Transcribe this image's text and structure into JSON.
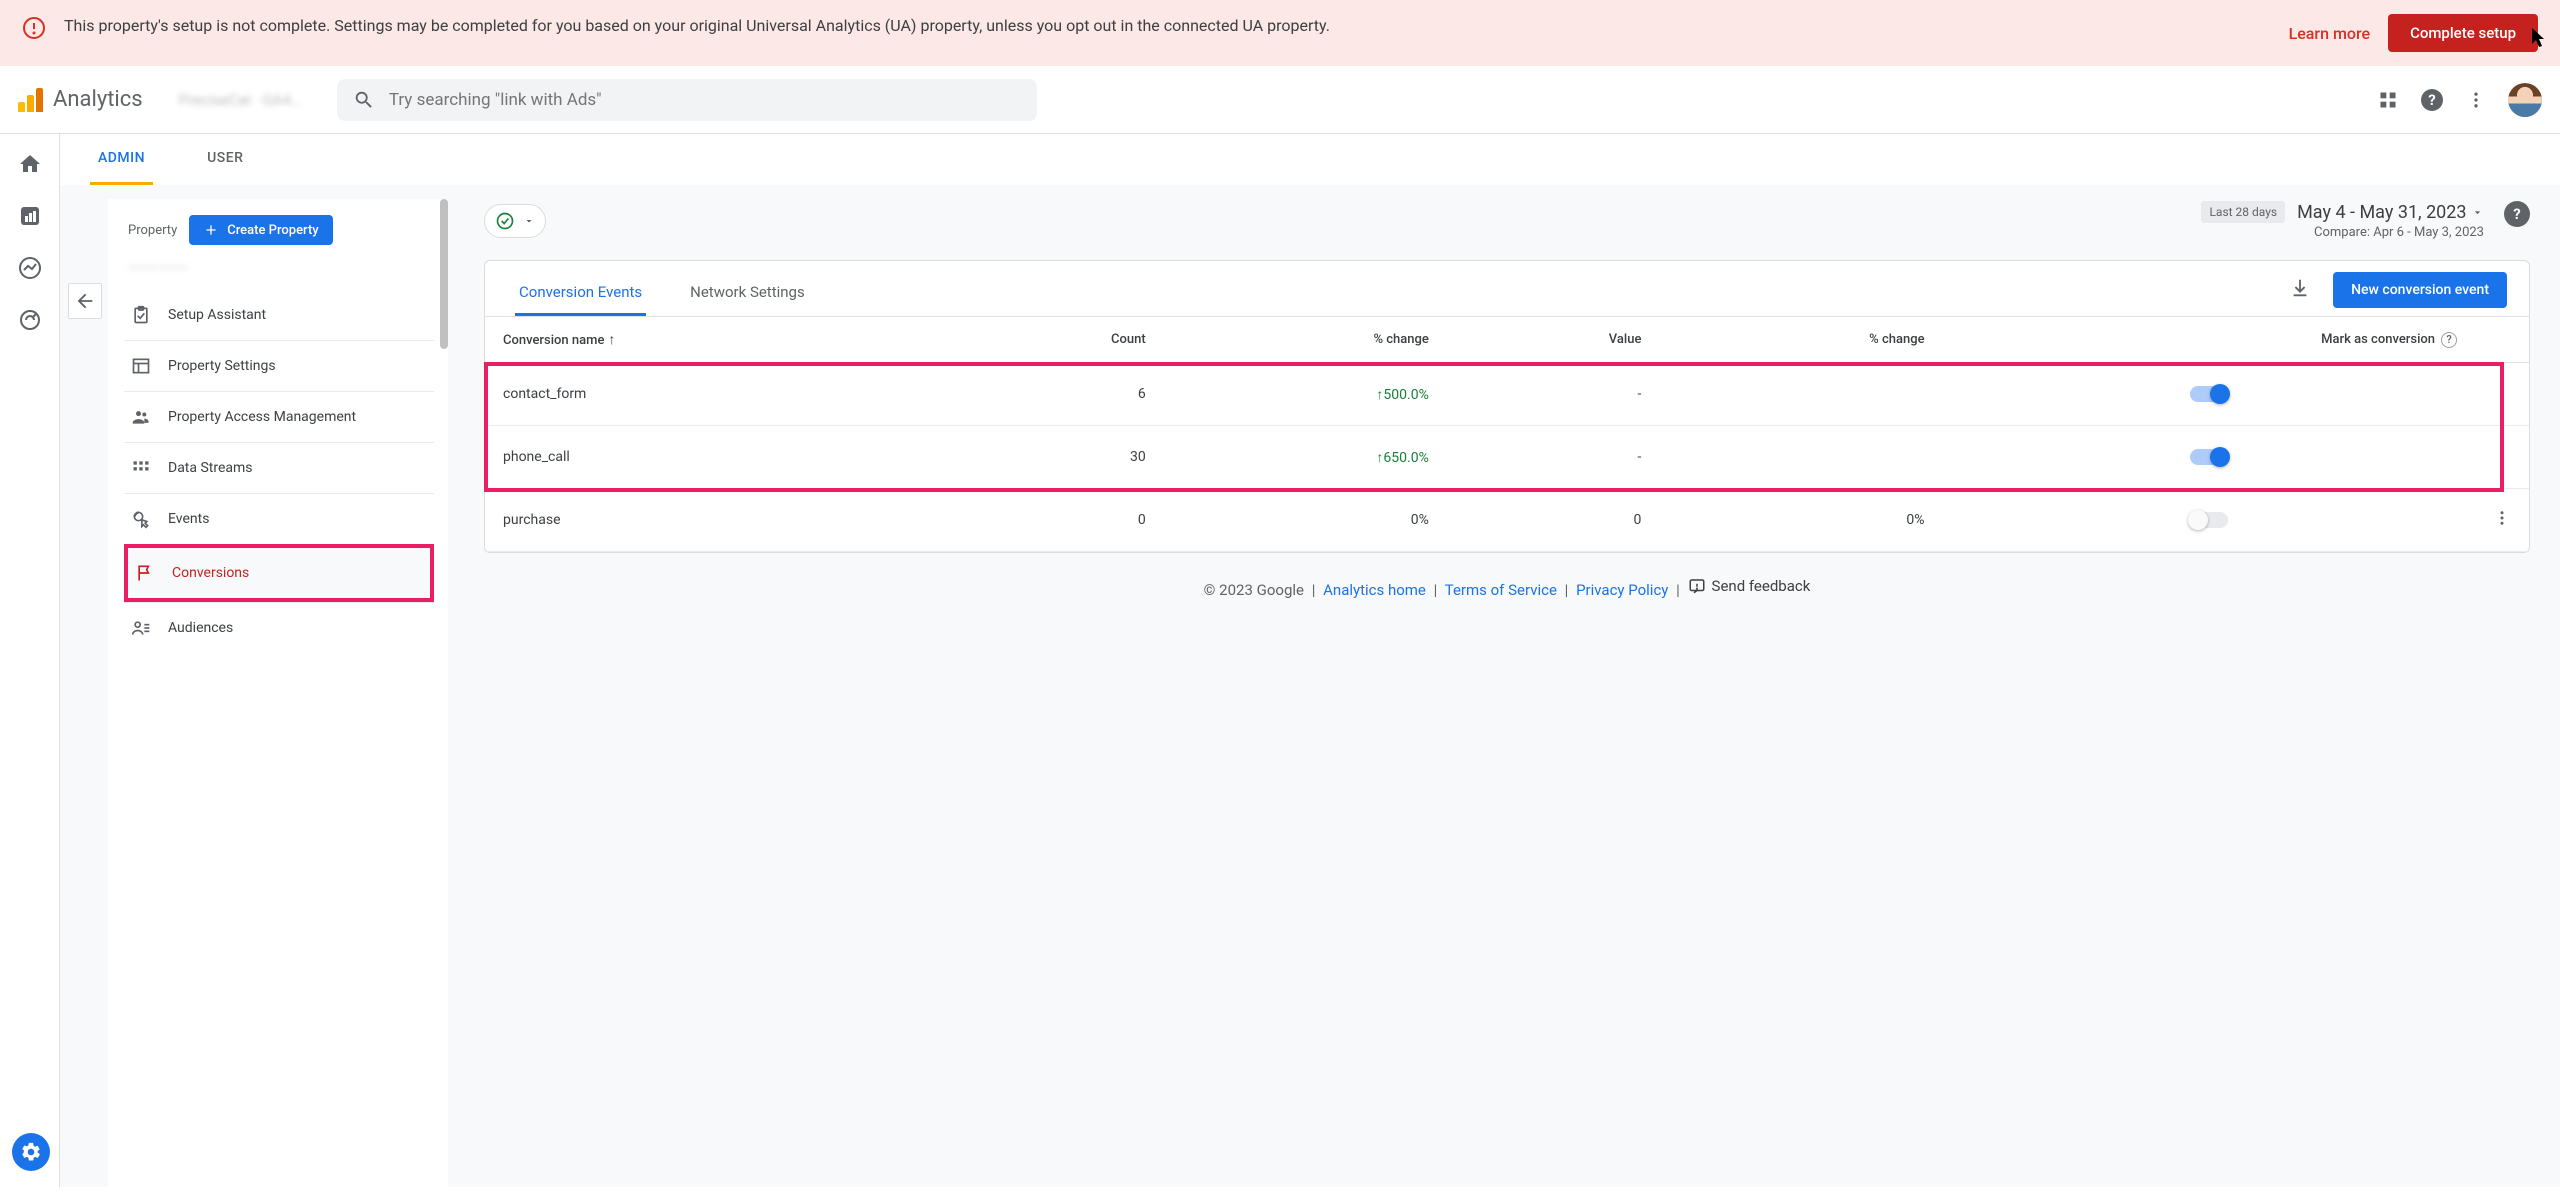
{
  "banner": {
    "text": "This property's setup is not complete. Settings may be completed for you based on your original Universal Analytics (UA) property, unless you opt out in the connected UA property.",
    "learn_more": "Learn more",
    "complete_btn": "Complete setup"
  },
  "header": {
    "product": "Analytics",
    "property_blurred": "PreciseCat · GA4…",
    "search_placeholder": "Try searching \"link with Ads\""
  },
  "admin_tabs": {
    "admin": "ADMIN",
    "user": "USER"
  },
  "property_col": {
    "label": "Property",
    "create_btn": "Create Property",
    "subtitle": "——————",
    "items": [
      {
        "label": "Setup Assistant"
      },
      {
        "label": "Property Settings"
      },
      {
        "label": "Property Access Management"
      },
      {
        "label": "Data Streams"
      },
      {
        "label": "Events"
      },
      {
        "label": "Conversions"
      },
      {
        "label": "Audiences"
      }
    ]
  },
  "date": {
    "chip": "Last 28 days",
    "range": "May 4 - May 31, 2023",
    "compare": "Compare: Apr 6 - May 3, 2023"
  },
  "card": {
    "tab_conv": "Conversion Events",
    "tab_net": "Network Settings",
    "new_btn": "New conversion event",
    "col_name": "Conversion name",
    "col_count": "Count",
    "col_pct1": "% change",
    "col_value": "Value",
    "col_pct2": "% change",
    "col_mark": "Mark as conversion"
  },
  "rows": [
    {
      "name": "contact_form",
      "count": "6",
      "pct1": "500.0%",
      "pct1_dir": "up",
      "value": "-",
      "pct2": "",
      "toggle": true,
      "highlight": true
    },
    {
      "name": "phone_call",
      "count": "30",
      "pct1": "650.0%",
      "pct1_dir": "up",
      "value": "-",
      "pct2": "",
      "toggle": true,
      "highlight": true
    },
    {
      "name": "purchase",
      "count": "0",
      "pct1": "0%",
      "pct1_dir": "none",
      "value": "0",
      "pct2": "0%",
      "toggle": false,
      "highlight": false
    }
  ],
  "footer": {
    "copyright": "© 2023 Google",
    "home": "Analytics home",
    "tos": "Terms of Service",
    "privacy": "Privacy Policy",
    "feedback": "Send feedback"
  }
}
